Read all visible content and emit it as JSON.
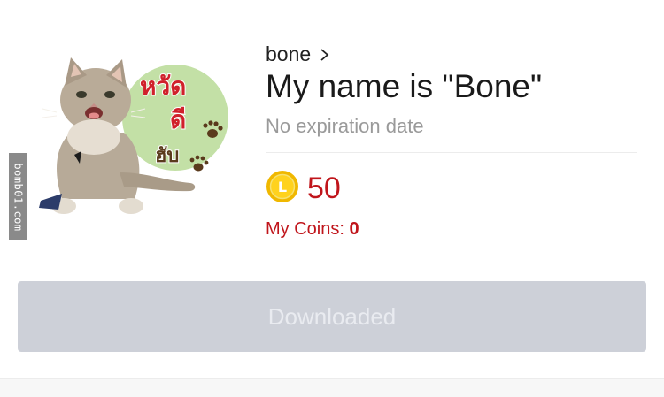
{
  "watermark": {
    "text": "bomb01.com"
  },
  "sticker": {
    "text_line1": "หวัด",
    "text_line2": "ดี",
    "text_line3": "ฮับ",
    "bubble_color": "#c3e0a6",
    "text_color": "#d0212b",
    "accent_color": "#5a3a1c"
  },
  "product": {
    "author": "bone",
    "title": "My name is \"Bone\"",
    "expiry": "No expiration date"
  },
  "price": {
    "coin_letter": "L",
    "amount": "50"
  },
  "balance": {
    "label": "My Coins:",
    "value": "0"
  },
  "download_button": {
    "label": "Downloaded",
    "state": "disabled"
  },
  "icons": {
    "chevron": "chevron-right-icon",
    "coin": "line-coin-icon",
    "paw": "paw-icon",
    "cat": "cat-illustration"
  }
}
